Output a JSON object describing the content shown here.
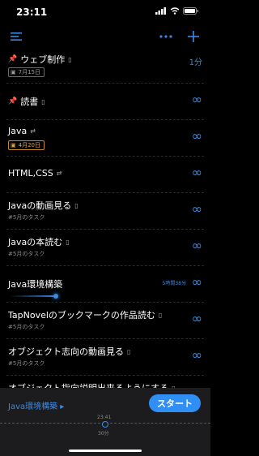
{
  "status": {
    "time": "23:11"
  },
  "colors": {
    "accent": "#3b8ae6",
    "pin": "#e0a040",
    "background": "#000000"
  },
  "toolbar": {
    "menu_icon": "list-menu-icon",
    "more_icon": "more-dots-icon",
    "add_icon": "plus-icon"
  },
  "tasks": [
    {
      "title": "ウェブ制作",
      "pinned": true,
      "sub": "7月15日",
      "badge_color": "gray",
      "right": "1分"
    },
    {
      "title": "読書",
      "pinned": true,
      "right": "∞"
    },
    {
      "title": "Java",
      "repeat": true,
      "sub": "4月20日",
      "badge_color": "orange",
      "right": "∞"
    },
    {
      "title": "HTML,CSS",
      "repeat": true,
      "right": "∞"
    },
    {
      "title": "Javaの動画見る",
      "sub": "#5月のタスク",
      "right": "∞"
    },
    {
      "title": "Javaの本読む",
      "sub": "#5月のタスク",
      "right": "∞"
    },
    {
      "title": "Java環境構築",
      "elapsed": "5時間38分",
      "right": "∞",
      "active": true
    },
    {
      "title": "TapNovelのブックマークの作品読む",
      "sub": "#5月のタスク",
      "right": "∞"
    },
    {
      "title": "オブジェクト志向の動画見る",
      "sub": "#5月のタスク",
      "right": "∞"
    },
    {
      "title": "オブジェクト指向説明出来るようにする"
    }
  ],
  "bottom": {
    "current_task": "Java環境構築 ▸",
    "start_label": "スタート",
    "timeline_time": "23:41",
    "duration": "30分"
  }
}
